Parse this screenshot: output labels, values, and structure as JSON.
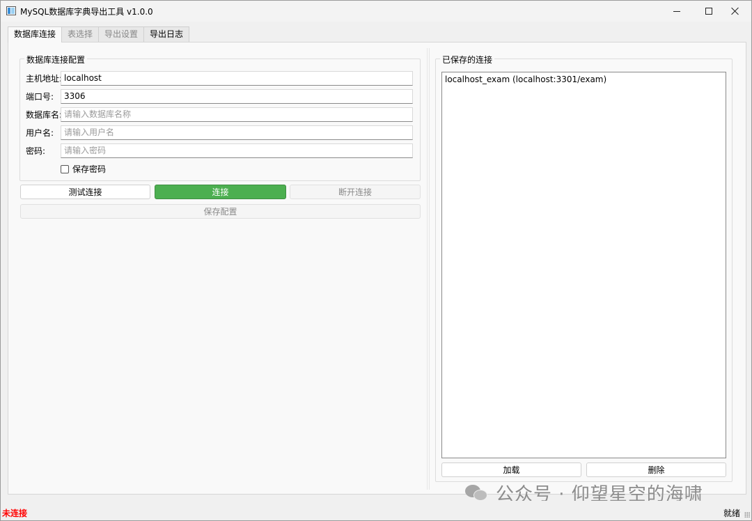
{
  "window": {
    "title": "MySQL数据库字典导出工具 v1.0.0"
  },
  "tabs": [
    {
      "label": "数据库连接",
      "active": true
    },
    {
      "label": "表选择",
      "active": false
    },
    {
      "label": "导出设置",
      "active": false
    },
    {
      "label": "导出日志",
      "active": false
    }
  ],
  "connection_form": {
    "group_title": "数据库连接配置",
    "host": {
      "label": "主机地址:",
      "value": "localhost",
      "placeholder": ""
    },
    "port": {
      "label": "端口号:",
      "value": "3306",
      "placeholder": ""
    },
    "database": {
      "label": "数据库名:",
      "value": "",
      "placeholder": "请输入数据库名称"
    },
    "username": {
      "label": "用户名:",
      "value": "",
      "placeholder": "请输入用户名"
    },
    "password": {
      "label": "密码:",
      "value": "",
      "placeholder": "请输入密码"
    },
    "save_password": {
      "label": "保存密码",
      "checked": false
    }
  },
  "buttons": {
    "test": "测试连接",
    "connect": "连接",
    "disconnect": "断开连接",
    "save_config": "保存配置",
    "load": "加载",
    "delete": "删除"
  },
  "saved_connections": {
    "group_title": "已保存的连接",
    "items": [
      "localhost_exam (localhost:3301/exam)"
    ]
  },
  "status": {
    "left": "未连接",
    "right": "就绪"
  },
  "watermark": {
    "text": "公众号 · 仰望星空的海啸"
  },
  "colors": {
    "connect_button": "#4caf50",
    "status_error": "#ff0000"
  }
}
